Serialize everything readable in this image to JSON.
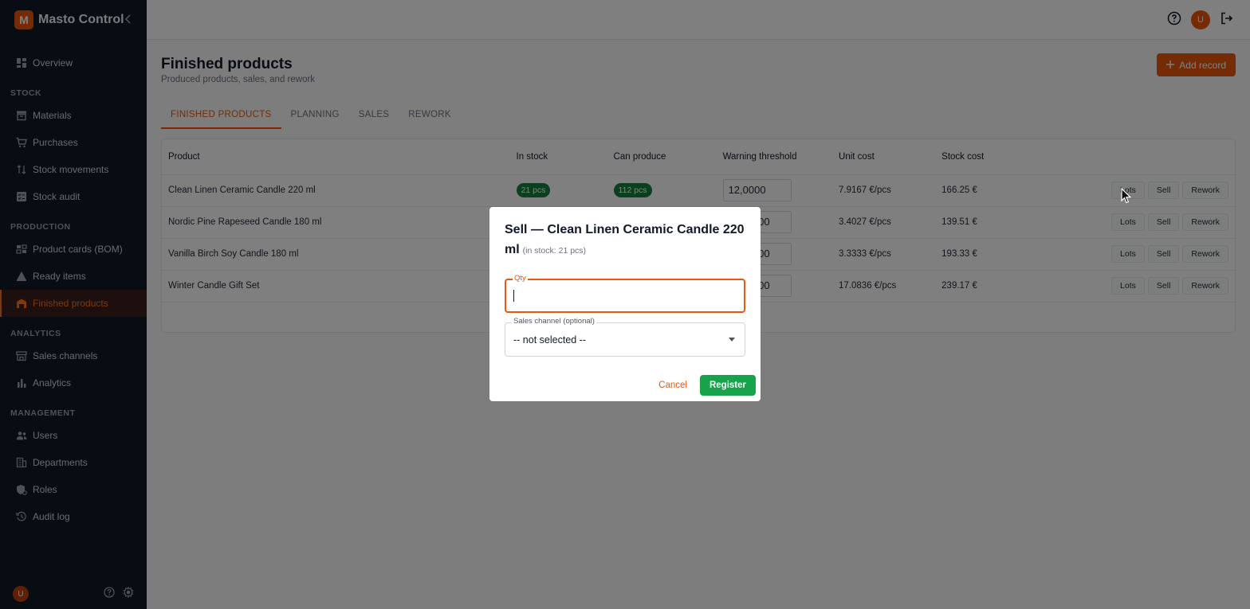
{
  "app": {
    "logo_letter": "M",
    "name": "Masto Control",
    "user_initial": "U"
  },
  "sidebar": {
    "items": [
      {
        "label": "Overview",
        "icon": "grid-icon"
      },
      {
        "section": "STOCK"
      },
      {
        "label": "Materials",
        "icon": "archive-icon"
      },
      {
        "label": "Purchases",
        "icon": "cart-icon"
      },
      {
        "label": "Stock movements",
        "icon": "arrows-icon"
      },
      {
        "label": "Stock audit",
        "icon": "checklist-icon"
      },
      {
        "section": "PRODUCTION"
      },
      {
        "label": "Product cards (BOM)",
        "icon": "cards-icon"
      },
      {
        "label": "Ready items",
        "icon": "flask-icon"
      },
      {
        "label": "Finished products",
        "icon": "warehouse-icon",
        "active": true
      },
      {
        "section": "ANALYTICS"
      },
      {
        "label": "Sales channels",
        "icon": "store-icon"
      },
      {
        "label": "Analytics",
        "icon": "bar-chart-icon"
      },
      {
        "section": "MANAGEMENT"
      },
      {
        "label": "Users",
        "icon": "users-icon"
      },
      {
        "label": "Departments",
        "icon": "building-icon"
      },
      {
        "label": "Roles",
        "icon": "shield-icon"
      },
      {
        "label": "Audit log",
        "icon": "history-icon"
      }
    ]
  },
  "page": {
    "title": "Finished products",
    "subtitle": "Produced products, sales, and rework",
    "add_label": "Add record",
    "tabs": [
      "FINISHED PRODUCTS",
      "PLANNING",
      "SALES",
      "REWORK"
    ],
    "active_tab": 0
  },
  "table": {
    "headers": [
      "Product",
      "In stock",
      "Can produce",
      "Warning threshold",
      "Unit cost",
      "Stock cost"
    ],
    "action_labels": {
      "lots": "Lots",
      "sell": "Sell",
      "rework": "Rework"
    },
    "rows": [
      {
        "product": "Clean Linen Ceramic Candle 220 ml",
        "in_stock": "21 pcs",
        "can_produce": "112 pcs",
        "threshold": "12,0000",
        "unit_cost": "7.9167 €/pcs",
        "stock_cost": "166.25 €"
      },
      {
        "product": "Nordic Pine Rapeseed Candle 180 ml",
        "in_stock": "",
        "can_produce": "",
        "threshold": "00",
        "unit_cost": "3.4027 €/pcs",
        "stock_cost": "139.51 €"
      },
      {
        "product": "Vanilla Birch Soy Candle 180 ml",
        "in_stock": "",
        "can_produce": "",
        "threshold": "000",
        "unit_cost": "3.3333 €/pcs",
        "stock_cost": "193.33 €"
      },
      {
        "product": "Winter Candle Gift Set",
        "in_stock": "",
        "can_produce": "",
        "threshold": "00",
        "unit_cost": "17.0836 €/pcs",
        "stock_cost": "239.17 €"
      }
    ]
  },
  "modal": {
    "title": "Sell — Clean Linen Ceramic Candle 220 ml",
    "stock_note": "(in stock: 21 pcs)",
    "qty_label": "Qty",
    "qty_value": "",
    "channel_label": "Sales channel (optional)",
    "channel_value": "-- not selected --",
    "cancel_label": "Cancel",
    "register_label": "Register"
  },
  "colors": {
    "accent": "#ea580c",
    "success": "#16a34a",
    "sidebar_bg": "#111827"
  }
}
